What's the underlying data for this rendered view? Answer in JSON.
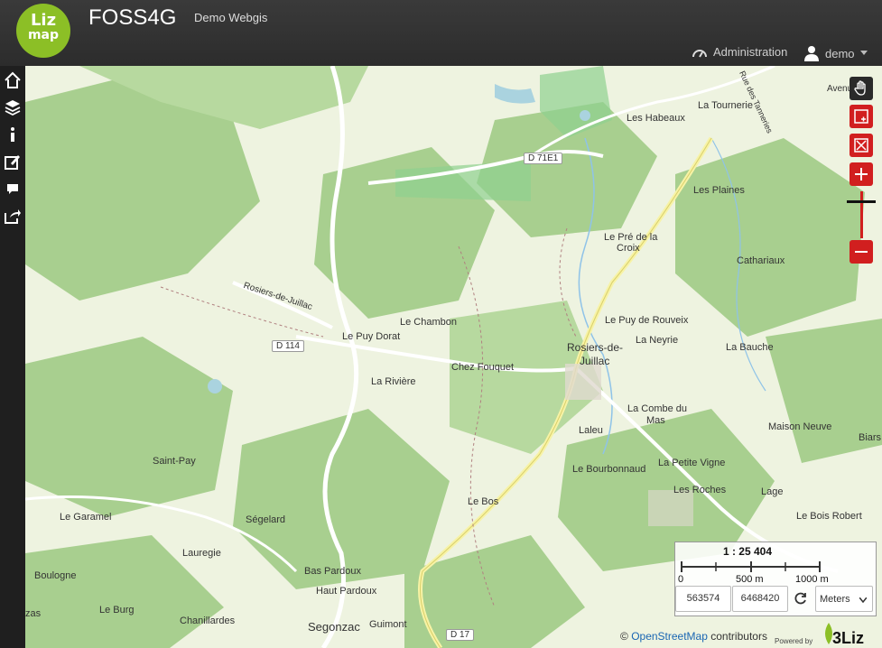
{
  "header": {
    "logo_line1": "Liz",
    "logo_line2": "map",
    "title": "FOSS4G",
    "subtitle": "Demo Webgis",
    "admin_label": "Administration",
    "user_label": "demo"
  },
  "sidebar": {
    "items": [
      {
        "icon": "home-icon"
      },
      {
        "icon": "layers-icon"
      },
      {
        "icon": "info-icon"
      },
      {
        "icon": "edit-icon"
      },
      {
        "icon": "comment-icon"
      },
      {
        "icon": "share-icon"
      }
    ]
  },
  "map": {
    "place_labels": [
      "La Tournerie",
      "Les Habeaux",
      "Les Plaines",
      "Le Pré de la",
      "Croix",
      "Cathariaux",
      "Le Chambon",
      "Le Puy de Rouveix",
      "Rosiers-de-",
      "Juillac",
      "La Neyrie",
      "La Bauche",
      "Le Puy Dorat",
      "Chez Fouquet",
      "La Rivière",
      "La Combe du",
      "Mas",
      "Laleu",
      "Maison Neuve",
      "Biars",
      "Le Bourbonnaud",
      "La Petite Vigne",
      "Saint-Pay",
      "Le Bos",
      "Les Roches",
      "Lage",
      "Le Bois Robert",
      "Le Garamel",
      "Ségelard",
      "Lauregie",
      "Boulogne",
      "Bas Pardoux",
      "Haut Pardoux",
      "Le Burg",
      "Chanillardes",
      "Segonzac",
      "Guimont",
      "Rosiers-de-Juillac",
      "Rue des Tanneries",
      "Avenue",
      "zas"
    ],
    "road_labels": [
      "D 71E1",
      "D 114",
      "D 17"
    ]
  },
  "tools": {
    "pan": "pan-hand-icon",
    "zoom_box": "zoom-box-icon",
    "zoom_extent": "zoom-extent-icon",
    "zoom_in": "plus-icon",
    "zoom_out": "minus-icon"
  },
  "scale": {
    "ratio": "1 : 25 404",
    "tick_0": "0",
    "tick_500": "500 m",
    "tick_1000": "1000 m"
  },
  "coords": {
    "x": "563574",
    "y": "6468420",
    "units": "Meters"
  },
  "attribution": {
    "prefix": "©",
    "link": "OpenStreetMap",
    "suffix": "contributors",
    "powered": "Powered by",
    "brand": "3Liz"
  },
  "colors": {
    "accent": "#d11f1f",
    "header": "#2f2f2f",
    "sidebar": "#1f1f1f",
    "forest_dark": "#a8cf8f",
    "forest_light": "#cde8b0",
    "brand_green": "#8cbf26"
  }
}
